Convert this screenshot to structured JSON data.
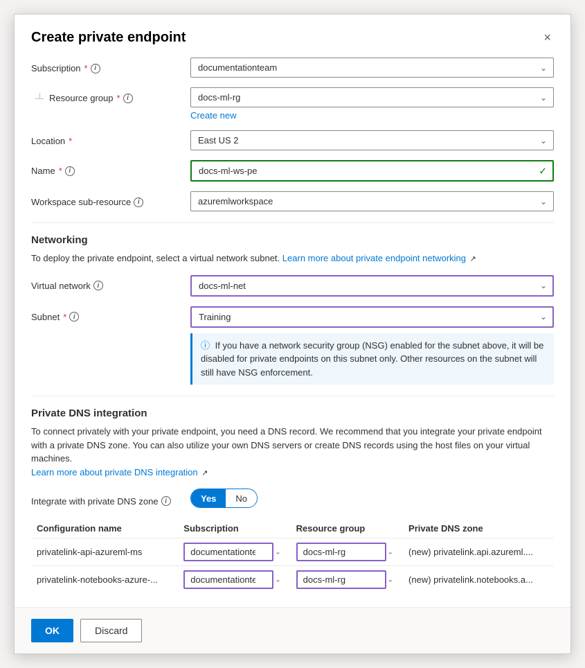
{
  "dialog": {
    "title": "Create private endpoint",
    "close_label": "×"
  },
  "fields": {
    "subscription": {
      "label": "Subscription",
      "required": true,
      "value": "documentationteam"
    },
    "resource_group": {
      "label": "Resource group",
      "required": true,
      "value": "docs-ml-rg",
      "create_new": "Create new"
    },
    "location": {
      "label": "Location",
      "required": true,
      "value": "East US 2"
    },
    "name": {
      "label": "Name",
      "required": true,
      "value": "docs-ml-ws-pe"
    },
    "workspace_sub_resource": {
      "label": "Workspace sub-resource",
      "required": false,
      "value": "azuremlworkspace"
    }
  },
  "networking": {
    "heading": "Networking",
    "description": "To deploy the private endpoint, select a virtual network subnet.",
    "link_text": "Learn more about private endpoint networking",
    "virtual_network": {
      "label": "Virtual network",
      "value": "docs-ml-net"
    },
    "subnet": {
      "label": "Subnet",
      "required": true,
      "value": "Training"
    },
    "nsg_notice": "If you have a network security group (NSG) enabled for the subnet above, it will be disabled for private endpoints on this subnet only. Other resources on the subnet will still have NSG enforcement."
  },
  "private_dns": {
    "heading": "Private DNS integration",
    "description": "To connect privately with your private endpoint, you need a DNS record. We recommend that you integrate your private endpoint with a private DNS zone. You can also utilize your own DNS servers or create DNS records using the host files on your virtual machines.",
    "link_text": "Learn more about private DNS integration",
    "integrate_label": "Integrate with private DNS zone",
    "toggle_yes": "Yes",
    "toggle_no": "No",
    "table": {
      "columns": [
        "Configuration name",
        "Subscription",
        "Resource group",
        "Private DNS zone"
      ],
      "rows": [
        {
          "config_name": "privatelink-api-azureml-ms",
          "subscription": "documentationteam",
          "resource_group": "docs-ml-rg",
          "dns_zone": "(new) privatelink.api.azureml...."
        },
        {
          "config_name": "privatelink-notebooks-azure-...",
          "subscription": "documentationteam",
          "resource_group": "docs-ml-rg",
          "dns_zone": "(new) privatelink.notebooks.a..."
        }
      ]
    }
  },
  "footer": {
    "ok_label": "OK",
    "discard_label": "Discard"
  }
}
